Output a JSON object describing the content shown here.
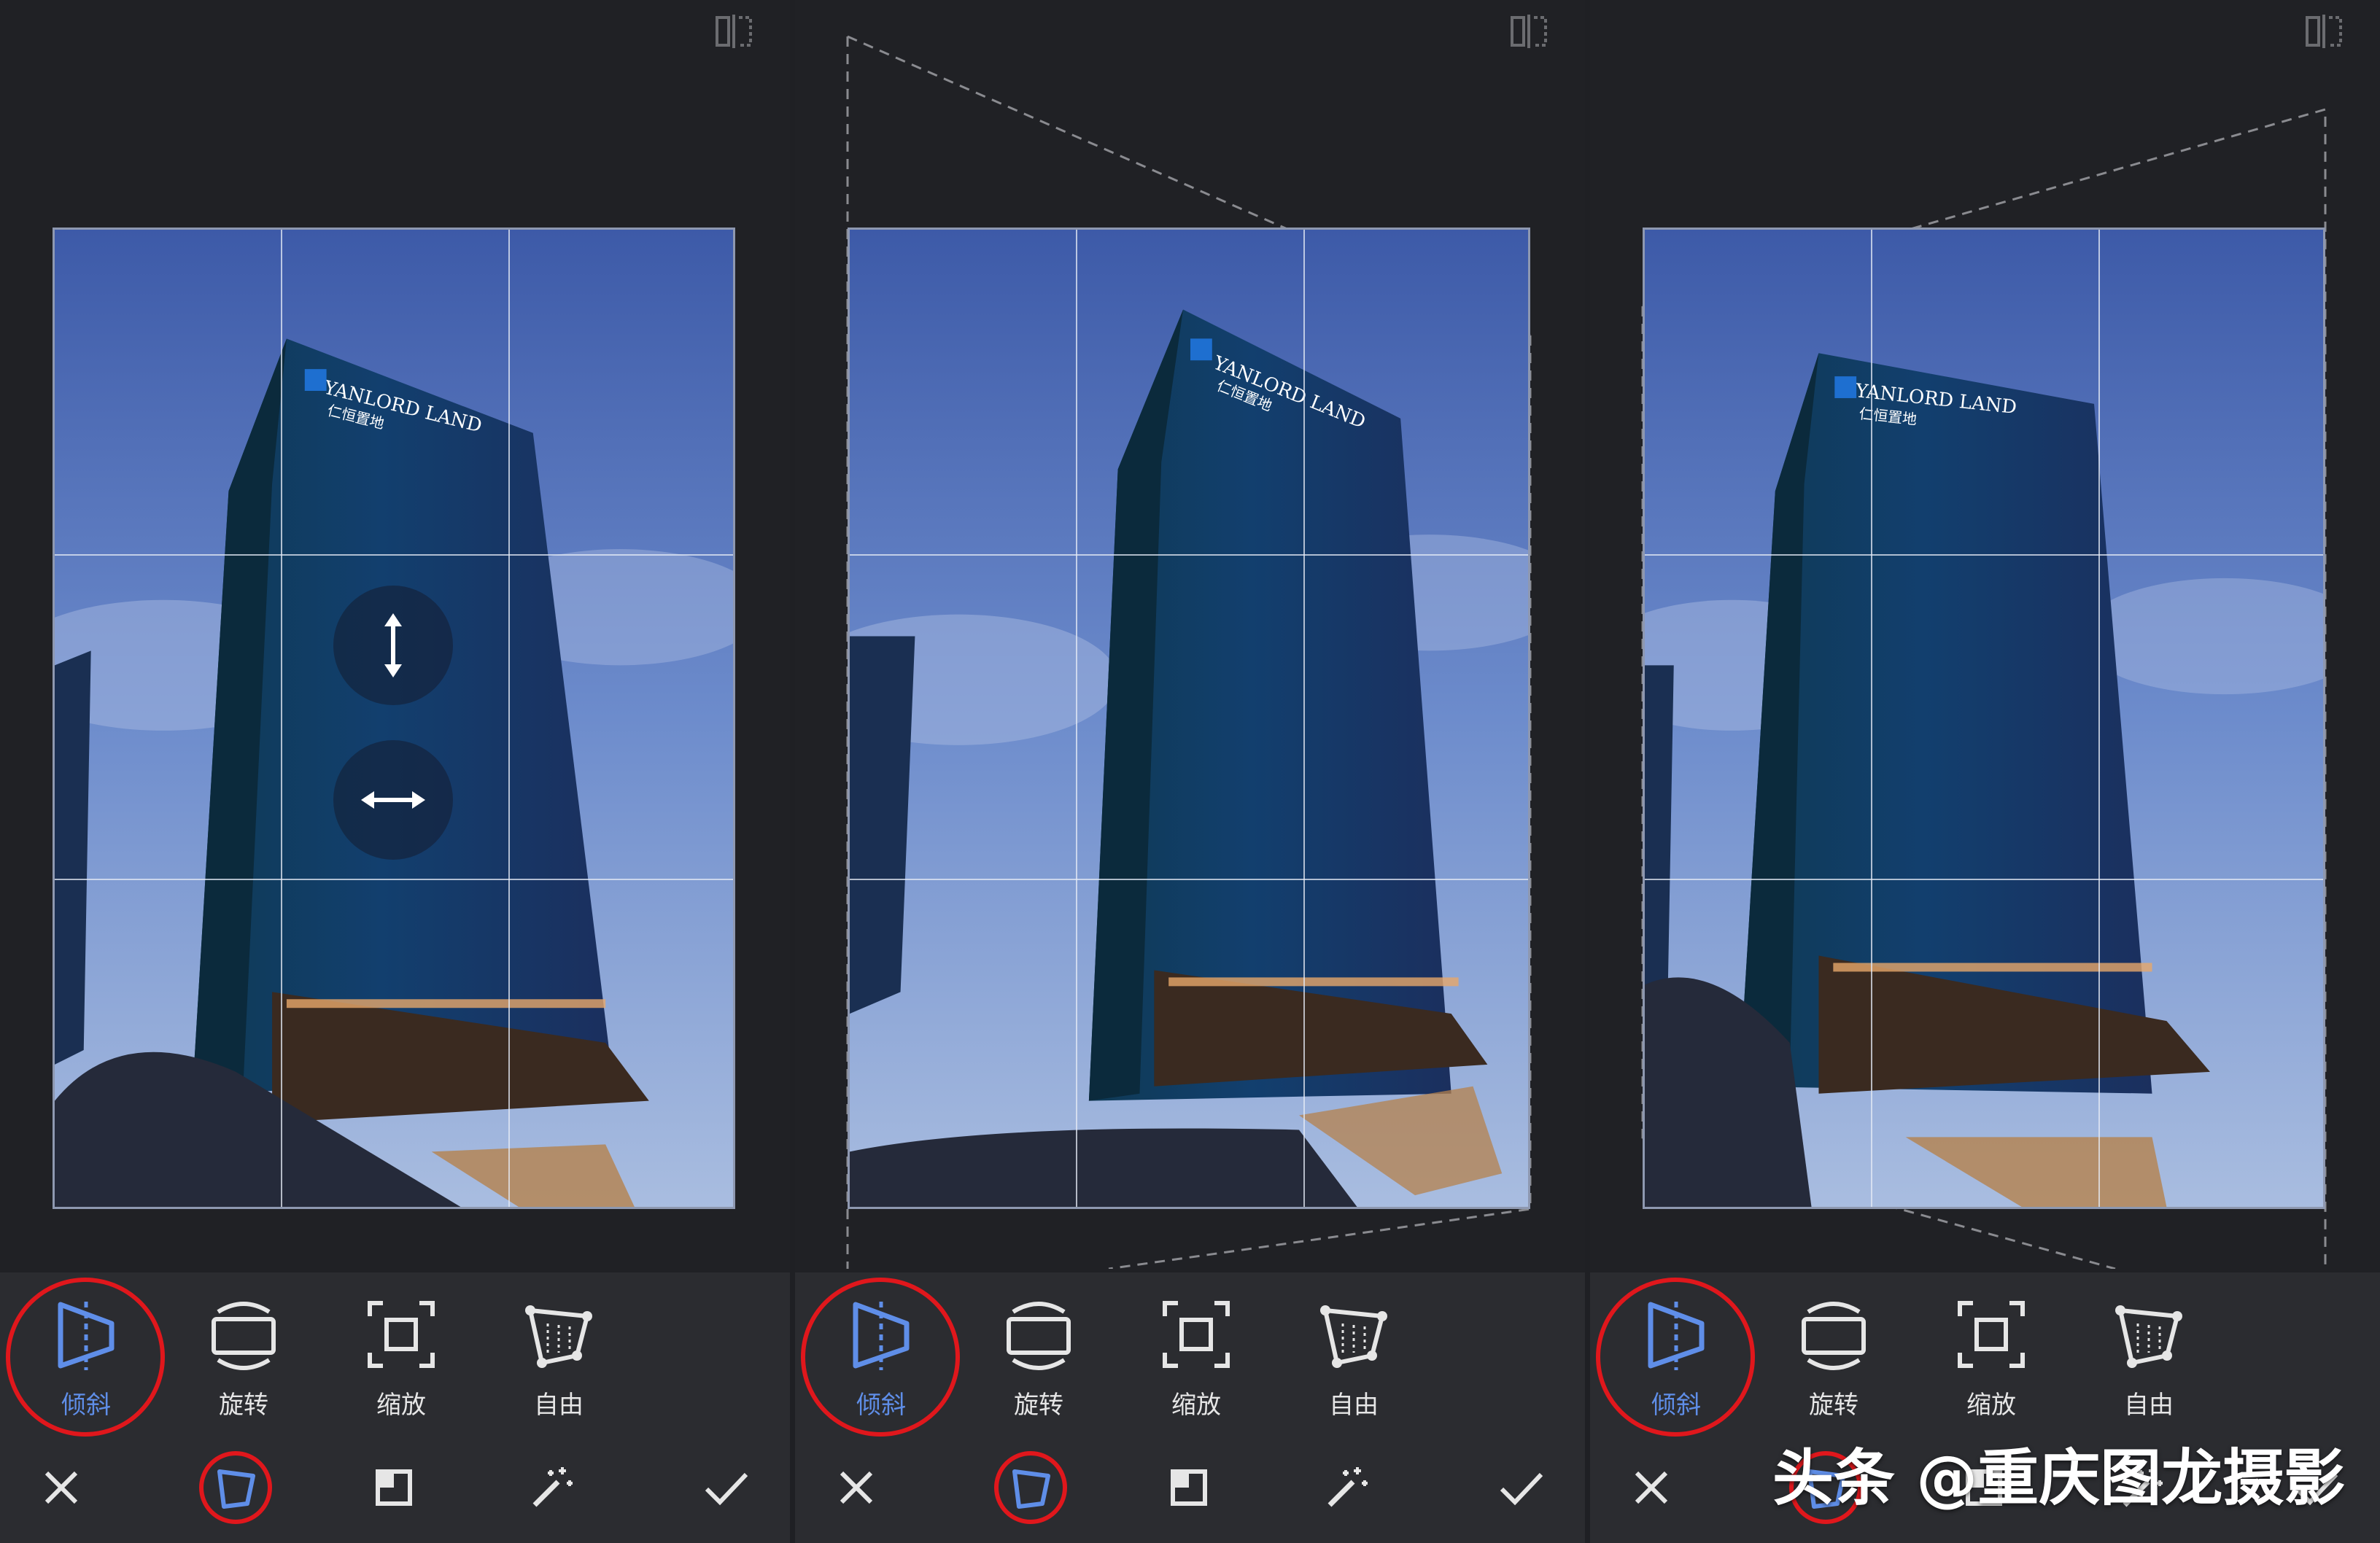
{
  "colors": {
    "accent_blue": "#5f8ee8",
    "highlight_red": "#e0171c",
    "toolbar_bg": "#2b2c30",
    "app_bg": "#202125",
    "label_text": "#e6e6e6"
  },
  "icons": {
    "compare": "compare-icon",
    "tilt": "tilt-perspective-icon",
    "rotate": "rotate-icon",
    "scale": "scale-icon",
    "free": "free-transform-icon",
    "cancel": "close-icon",
    "perspective_tab": "perspective-icon",
    "expand": "expand-icon",
    "magic": "magic-wand-icon",
    "apply": "checkmark-icon"
  },
  "photo": {
    "sign_en": "YANLORD LAND",
    "sign_cn": "仁恒置地"
  },
  "panels": [
    {
      "tools": {
        "tilt": "倾斜",
        "rotate": "旋转",
        "scale": "缩放",
        "free": "自由"
      }
    },
    {
      "tools": {
        "tilt": "倾斜",
        "rotate": "旋转",
        "scale": "缩放",
        "free": "自由"
      }
    },
    {
      "tools": {
        "tilt": "倾斜",
        "rotate": "旋转",
        "scale": "缩放",
        "free": "自由"
      }
    }
  ],
  "watermark": "头条 @重庆图龙摄影"
}
